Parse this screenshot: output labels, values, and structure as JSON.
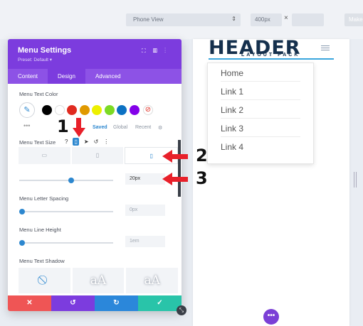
{
  "toolbar": {
    "view_select": "Phone View",
    "width_value": "400px",
    "close_x": "×",
    "make_button": "Make"
  },
  "preview": {
    "logo_title": "HEADER",
    "logo_subtitle": "LAYOUT PACK",
    "menu_items": [
      "Home",
      "Link 1",
      "Link 2",
      "Link 3",
      "Link 4"
    ],
    "fab_icon": "more-icon"
  },
  "panel": {
    "title": "Menu Settings",
    "preset": "Preset: Default ▾",
    "tabs": [
      "Content",
      "Design",
      "Advanced"
    ],
    "active_tab": "Design",
    "menu_text_color_label": "Menu Text Color",
    "swatch_colors": [
      "#000000",
      "#ffffff",
      "#e02b20",
      "#e09900",
      "#edf000",
      "#7cda24",
      "#0c71c3",
      "#8300e9"
    ],
    "saved_tabs": [
      "Saved",
      "Global",
      "Recent"
    ],
    "menu_text_size_label": "Menu Text Size",
    "devices": [
      "desktop-icon",
      "tablet-icon",
      "phone-icon"
    ],
    "text_size_value": "20px",
    "text_size_fraction": 0.55,
    "letter_spacing_label": "Menu Letter Spacing",
    "letter_spacing_value": "0px",
    "line_height_label": "Menu Line Height",
    "line_height_value": "1em",
    "text_shadow_label": "Menu Text Shadow",
    "shadow_preview_text": "aA"
  },
  "footer": {
    "colors": [
      "#ef5555",
      "#7c3cde",
      "#2b87da",
      "#29c4a9"
    ]
  },
  "callouts": {
    "one": "1",
    "two": "2",
    "three": "3",
    "color": "#e8202a"
  }
}
